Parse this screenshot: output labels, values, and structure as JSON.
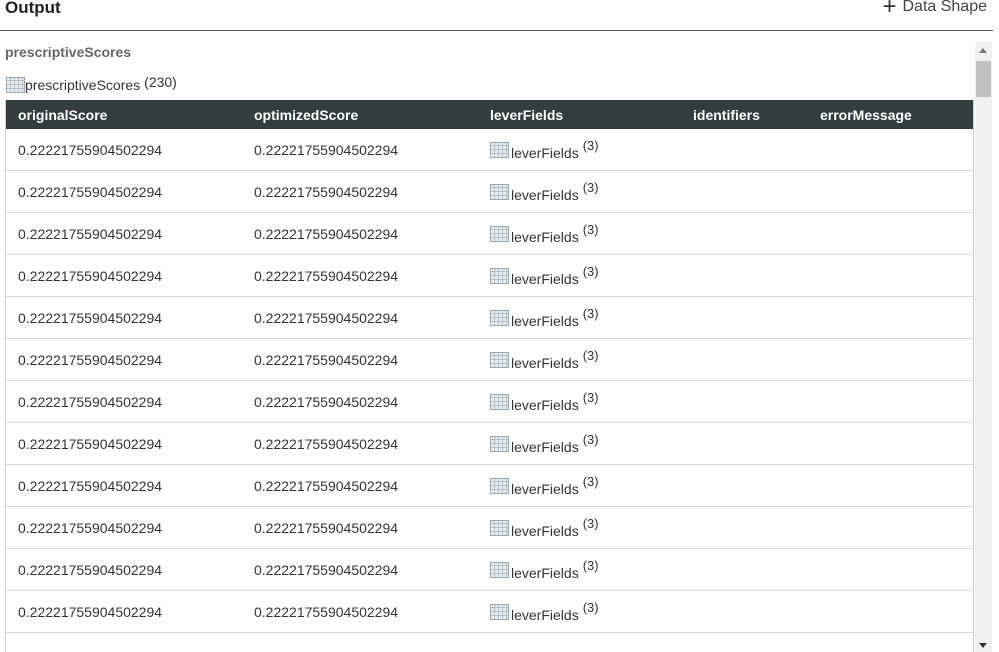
{
  "header": {
    "title": "Output",
    "data_shape_label": "Data Shape"
  },
  "section": {
    "label": "prescriptiveScores",
    "table_label": "prescriptiveScores",
    "row_count": "(230)"
  },
  "table": {
    "columns": [
      "originalScore",
      "optimizedScore",
      "leverFields",
      "identifiers",
      "errorMessage"
    ],
    "rows": [
      {
        "originalScore": "0.22221755904502294",
        "optimizedScore": "0.22221755904502294",
        "leverFields": "leverFields",
        "leverCount": "(3)",
        "identifiers": "",
        "errorMessage": ""
      },
      {
        "originalScore": "0.22221755904502294",
        "optimizedScore": "0.22221755904502294",
        "leverFields": "leverFields",
        "leverCount": "(3)",
        "identifiers": "",
        "errorMessage": ""
      },
      {
        "originalScore": "0.22221755904502294",
        "optimizedScore": "0.22221755904502294",
        "leverFields": "leverFields",
        "leverCount": "(3)",
        "identifiers": "",
        "errorMessage": ""
      },
      {
        "originalScore": "0.22221755904502294",
        "optimizedScore": "0.22221755904502294",
        "leverFields": "leverFields",
        "leverCount": "(3)",
        "identifiers": "",
        "errorMessage": ""
      },
      {
        "originalScore": "0.22221755904502294",
        "optimizedScore": "0.22221755904502294",
        "leverFields": "leverFields",
        "leverCount": "(3)",
        "identifiers": "",
        "errorMessage": ""
      },
      {
        "originalScore": "0.22221755904502294",
        "optimizedScore": "0.22221755904502294",
        "leverFields": "leverFields",
        "leverCount": "(3)",
        "identifiers": "",
        "errorMessage": ""
      },
      {
        "originalScore": "0.22221755904502294",
        "optimizedScore": "0.22221755904502294",
        "leverFields": "leverFields",
        "leverCount": "(3)",
        "identifiers": "",
        "errorMessage": ""
      },
      {
        "originalScore": "0.22221755904502294",
        "optimizedScore": "0.22221755904502294",
        "leverFields": "leverFields",
        "leverCount": "(3)",
        "identifiers": "",
        "errorMessage": ""
      },
      {
        "originalScore": "0.22221755904502294",
        "optimizedScore": "0.22221755904502294",
        "leverFields": "leverFields",
        "leverCount": "(3)",
        "identifiers": "",
        "errorMessage": ""
      },
      {
        "originalScore": "0.22221755904502294",
        "optimizedScore": "0.22221755904502294",
        "leverFields": "leverFields",
        "leverCount": "(3)",
        "identifiers": "",
        "errorMessage": ""
      },
      {
        "originalScore": "0.22221755904502294",
        "optimizedScore": "0.22221755904502294",
        "leverFields": "leverFields",
        "leverCount": "(3)",
        "identifiers": "",
        "errorMessage": ""
      },
      {
        "originalScore": "0.22221755904502294",
        "optimizedScore": "0.22221755904502294",
        "leverFields": "leverFields",
        "leverCount": "(3)",
        "identifiers": "",
        "errorMessage": ""
      }
    ]
  },
  "colors": {
    "header_bg": "#333d3d",
    "row_border": "#d9d9d9"
  },
  "icons": {
    "add": "plus-icon",
    "table": "table-grid-icon",
    "scroll_up": "chevron-up-icon",
    "scroll_down": "chevron-down-icon"
  }
}
